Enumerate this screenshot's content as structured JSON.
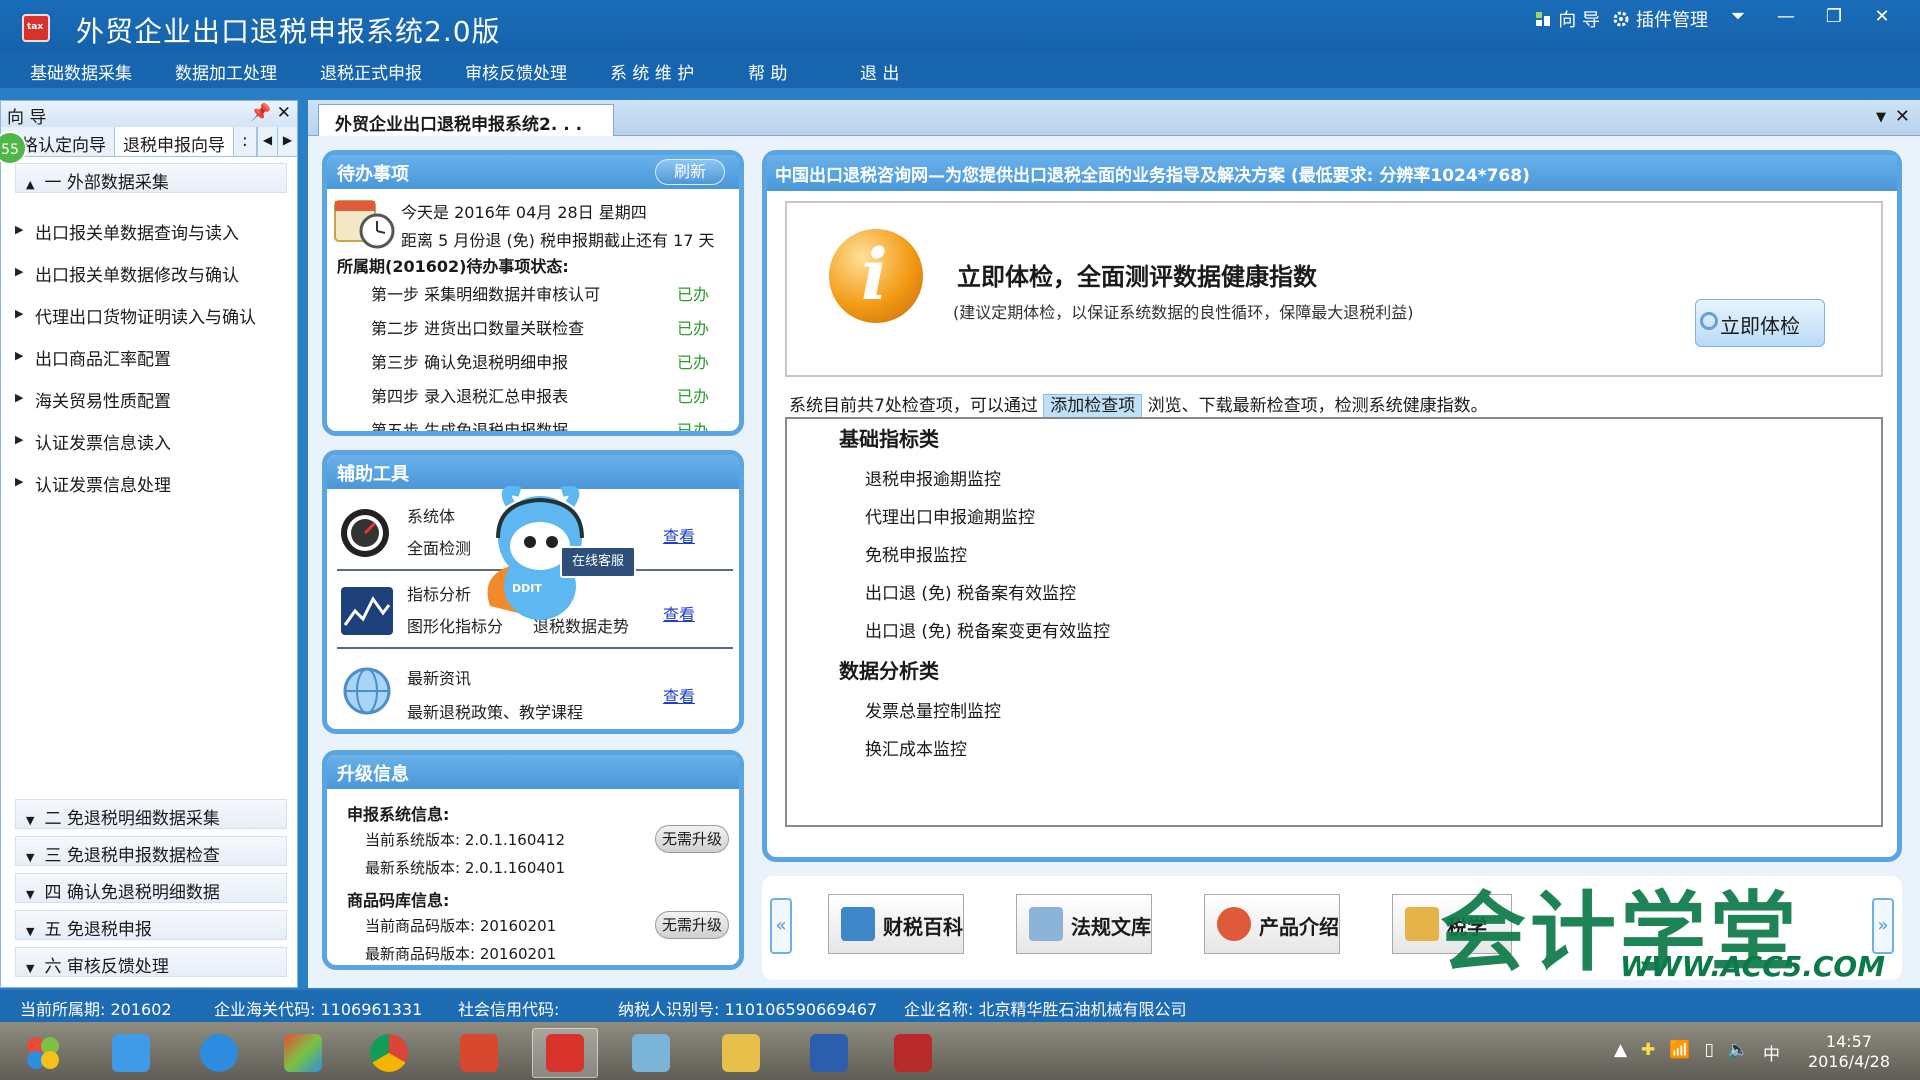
{
  "app": {
    "title": "外贸企业出口退税申报系统2.0版",
    "guide": "向 导",
    "plugin": "插件管理"
  },
  "menu": [
    "基础数据采集",
    "数据加工处理",
    "退税正式申报",
    "审核反馈处理",
    "系 统 维 护",
    "帮  助",
    "退  出"
  ],
  "left": {
    "header": "向 导",
    "tabs": [
      "格认定向导",
      "退税申报向导",
      ":"
    ],
    "badge": "55",
    "group1": "一  外部数据采集",
    "items": [
      "出口报关单数据查询与读入",
      "出口报关单数据修改与确认",
      "代理出口货物证明读入与确认",
      "出口商品汇率配置",
      "海关贸易性质配置",
      "认证发票信息读入",
      "认证发票信息处理"
    ],
    "groups": [
      "二  免退税明细数据采集",
      "三  免退税申报数据检查",
      "四  确认免退税明细数据",
      "五  免退税申报",
      "六  审核反馈处理"
    ]
  },
  "main": {
    "tab_label": "外贸企业出口退税申报系统2. . .",
    "todo": {
      "title": "待办事项",
      "refresh": "刷新",
      "today": "今天是  2016年  04月  28日  星期四",
      "deadline": "距离  5  月份退 (免) 税申报期截止还有  17  天",
      "period": "所属期(201602)待办事项状态:",
      "steps": [
        {
          "label": "第一步  采集明细数据并审核认可",
          "status": "已办"
        },
        {
          "label": "第二步  进货出口数量关联检查",
          "status": "已办"
        },
        {
          "label": "第三步  确认免退税明细申报",
          "status": "已办"
        },
        {
          "label": "第四步  录入退税汇总申报表",
          "status": "已办"
        },
        {
          "label": "第五步  生成免退税申报数据",
          "status": "已办"
        }
      ]
    },
    "tools": {
      "title": "辅助工具",
      "rows": [
        {
          "name": "系统体",
          "desc": "全面检测",
          "link": "查看"
        },
        {
          "name": "指标分析",
          "desc": "图形化指标分",
          "desc2": "退税数据走势",
          "link": "查看"
        },
        {
          "name": "最新资讯",
          "desc": "最新退税政策、教学课程",
          "link": "查看"
        }
      ],
      "mascot_tag": "在线客服",
      "mascot_brand": "DDIT"
    },
    "upgrade": {
      "title": "升级信息",
      "sys_label": "申报系统信息:",
      "sys_cur": "当前系统版本: 2.0.1.160412",
      "sys_new": "最新系统版本: 2.0.1.160401",
      "code_label": "商品码库信息:",
      "code_cur": "当前商品码版本: 20160201",
      "code_new": "最新商品码版本: 20160201",
      "btn": "无需升级"
    },
    "health": {
      "header": "中国出口退税咨询网—为您提供出口退税全面的业务指导及解决方案 (最低要求: 分辨率1024*768)",
      "title": "立即体检，全面测评数据健康指数",
      "subtitle": "(建议定期体检，以保证系统数据的良性循环，保障最大退税利益)",
      "button": "立即体检",
      "hint_pre": "系统目前共7处检查项，可以通过",
      "hint_link": "添加检查项",
      "hint_post": "浏览、下载最新检查项，检测系统健康指数。",
      "cat1": "基础指标类",
      "cat1_items": [
        "退税申报逾期监控",
        "代理出口申报逾期监控",
        "免税申报监控",
        "出口退 (免) 税备案有效监控",
        "出口退 (免) 税备案变更有效监控"
      ],
      "cat2": "数据分析类",
      "cat2_items": [
        "发票总量控制监控",
        "换汇成本监控"
      ]
    },
    "strip": {
      "left": "«",
      "right": "»",
      "buttons": [
        "财税百科",
        "法规文库",
        "产品介绍",
        "税学"
      ]
    },
    "watermark": "会计学堂",
    "watermark_url": "WWW.ACC5.COM"
  },
  "status": {
    "period": "当前所属期: 201602",
    "customs": "企业海关代码: 1106961331",
    "credit": "社会信用代码:",
    "taxid": "纳税人识别号: 110106590669467",
    "name": "企业名称: 北京精华胜石油机械有限公司"
  },
  "taskbar": {
    "time": "14:57",
    "date": "2016/4/28",
    "ime": "中"
  },
  "colors": {
    "titlebar": "#1a6db9",
    "card_border": "#5aa4e2",
    "done": "#2a9d2a",
    "watermark": "#0c7a48"
  }
}
